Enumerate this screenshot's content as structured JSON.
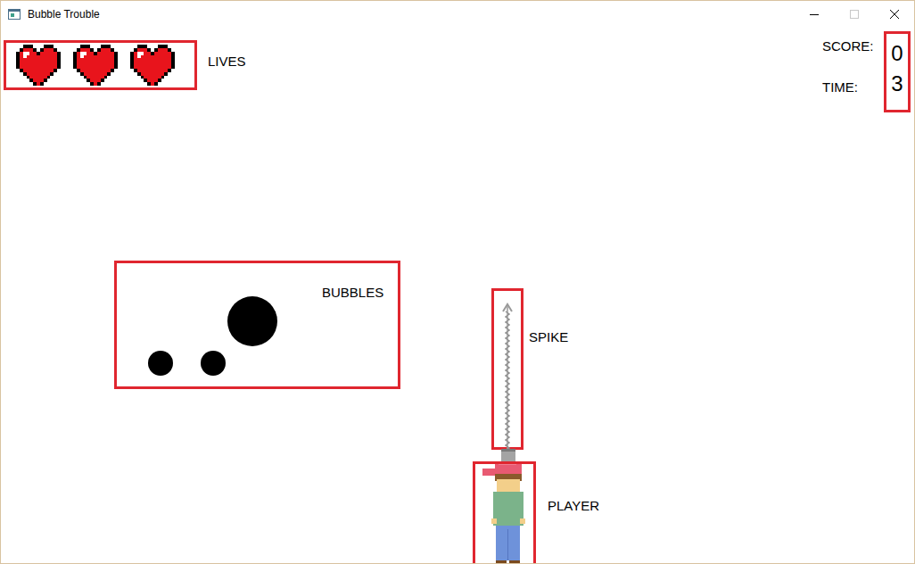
{
  "window": {
    "title": "Bubble Trouble"
  },
  "lives": {
    "label": "LIVES",
    "hearts": [
      {
        "full": true
      },
      {
        "full": true
      },
      {
        "full": true
      }
    ]
  },
  "hud": {
    "score_label": "SCORE:",
    "score": "0",
    "time_label": "TIME:",
    "time": "3"
  },
  "bubbles": {
    "label": "BUBBLES",
    "items": [
      {
        "kind": "large"
      },
      {
        "kind": "small"
      },
      {
        "kind": "small"
      }
    ]
  },
  "spike": {
    "label": "SPIKE"
  },
  "player": {
    "label": "PLAYER"
  }
}
